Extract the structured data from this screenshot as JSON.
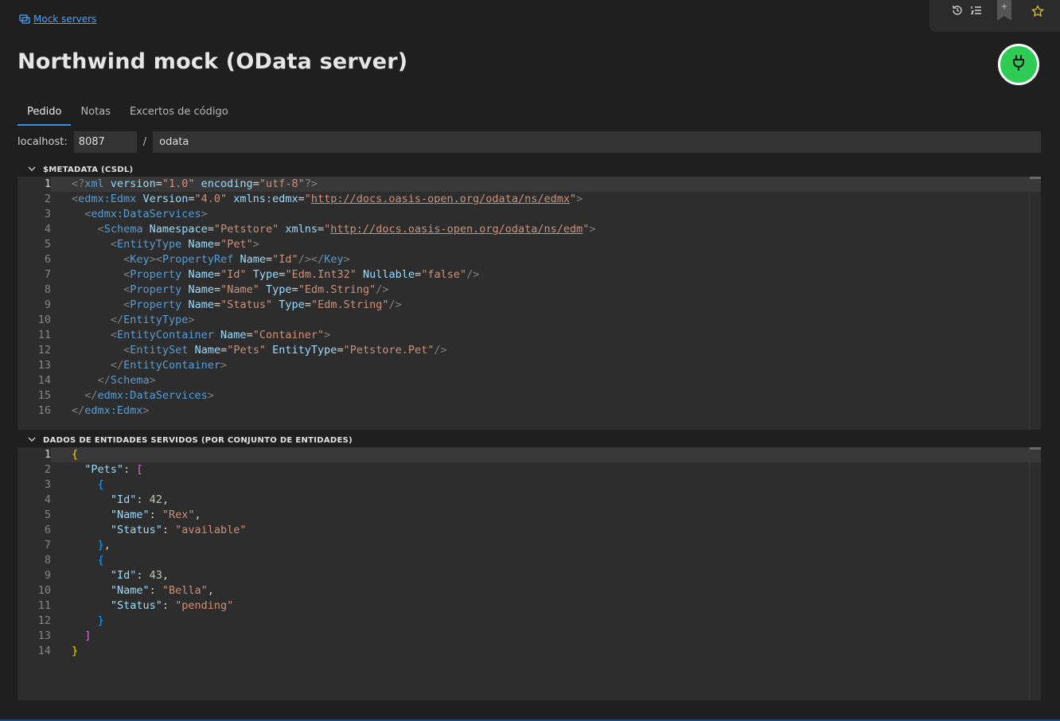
{
  "breadcrumb": {
    "label": "Mock servers"
  },
  "page": {
    "title": "Northwind mock (OData server)"
  },
  "toolbar": {
    "icons": [
      "history-icon",
      "list-icon",
      "bookmark-icon",
      "star-icon"
    ]
  },
  "power_button": {
    "icon": "plug-icon",
    "color": "#2ecc55"
  },
  "tabs": [
    {
      "label": "Pedido",
      "active": true
    },
    {
      "label": "Notas",
      "active": false
    },
    {
      "label": "Excertos de código",
      "active": false
    }
  ],
  "url": {
    "host_label": "localhost:",
    "port": "8087",
    "separator": "/",
    "path": "odata"
  },
  "metadata_section": {
    "title": "$METADATA (CSDL)",
    "lines": [
      "<?xml version=\"1.0\" encoding=\"utf-8\"?>",
      "<edmx:Edmx Version=\"4.0\" xmlns:edmx=\"http://docs.oasis-open.org/odata/ns/edmx\">",
      "  <edmx:DataServices>",
      "    <Schema Namespace=\"Petstore\" xmlns=\"http://docs.oasis-open.org/odata/ns/edm\">",
      "      <EntityType Name=\"Pet\">",
      "        <Key><PropertyRef Name=\"Id\"/></Key>",
      "        <Property Name=\"Id\" Type=\"Edm.Int32\" Nullable=\"false\"/>",
      "        <Property Name=\"Name\" Type=\"Edm.String\"/>",
      "        <Property Name=\"Status\" Type=\"Edm.String\"/>",
      "      </EntityType>",
      "      <EntityContainer Name=\"Container\">",
      "        <EntitySet Name=\"Pets\" EntityType=\"Petstore.Pet\"/>",
      "      </EntityContainer>",
      "    </Schema>",
      "  </edmx:DataServices>",
      "</edmx:Edmx>"
    ]
  },
  "data_section": {
    "title": "DADOS DE ENTIDADES SERVIDOS (POR CONJUNTO DE ENTIDADES)",
    "lines": [
      "{",
      "  \"Pets\": [",
      "    {",
      "      \"Id\": 42,",
      "      \"Name\": \"Rex\",",
      "      \"Status\": \"available\"",
      "    },",
      "    {",
      "      \"Id\": 43,",
      "      \"Name\": \"Bella\",",
      "      \"Status\": \"pending\"",
      "    }",
      "  ]",
      "}"
    ]
  },
  "colors": {
    "accent": "#3b8fe0",
    "link": "#4aa3ff",
    "background": "#1f1f1f",
    "editor": "#2d2d2d"
  }
}
